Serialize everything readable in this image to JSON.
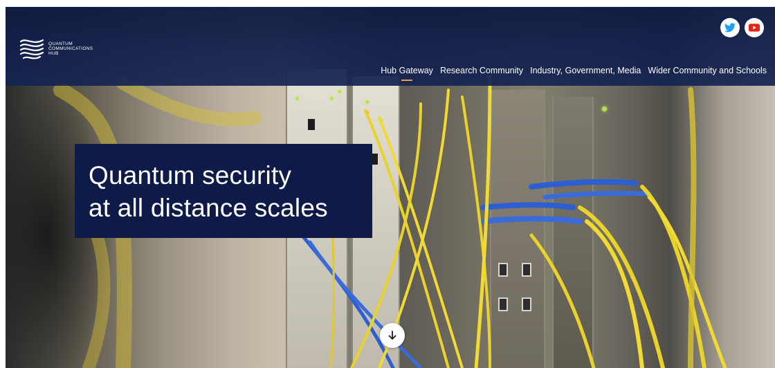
{
  "logo": {
    "lines": [
      "QUANTUM",
      "COMMUNICATIONS",
      "HUB"
    ]
  },
  "social": [
    {
      "name": "twitter",
      "icon": "twitter-icon",
      "color": "#1da1f2"
    },
    {
      "name": "youtube",
      "icon": "youtube-icon",
      "color": "#e62117"
    }
  ],
  "nav": {
    "items": [
      {
        "label": "Hub Gateway",
        "active": true
      },
      {
        "label": "Research Community",
        "active": false
      },
      {
        "label": "Industry, Government, Media",
        "active": false
      },
      {
        "label": "Wider Community and Schools",
        "active": false
      }
    ]
  },
  "hero": {
    "title_line1": "Quantum security",
    "title_line2": "at all distance scales"
  },
  "scroll_button": {
    "icon": "arrow-down-icon"
  },
  "colors": {
    "header_bg": "#0e1b42",
    "card_bg": "#0e1b49",
    "nav_active_underline": "#e4a43b",
    "cable_yellow": "#e8d22b",
    "cable_blue": "#2d5fd0"
  }
}
